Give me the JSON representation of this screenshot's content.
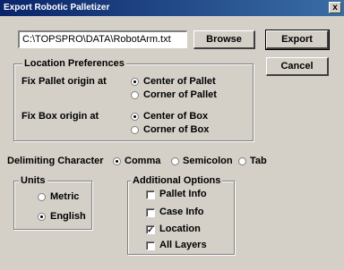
{
  "window": {
    "title": "Export Robotic Palletizer",
    "close_glyph": "x"
  },
  "file": {
    "path_value": "C:\\TOPSPRO\\DATA\\RobotArm.txt",
    "browse_label": "Browse"
  },
  "buttons": {
    "export_label": "Export",
    "cancel_label": "Cancel"
  },
  "location_prefs": {
    "title": "Location Preferences",
    "pallet_label": "Fix Pallet origin at",
    "pallet_options": [
      "Center of Pallet",
      "Corner of Pallet"
    ],
    "pallet_selected": "Center of Pallet",
    "box_label": "Fix Box origin at",
    "box_options": [
      "Center of Box",
      "Corner of Box"
    ],
    "box_selected": "Center of Box"
  },
  "delimiter": {
    "label": "Delimiting Character",
    "options": [
      "Comma",
      "Semicolon",
      "Tab"
    ],
    "selected": "Comma"
  },
  "units": {
    "title": "Units",
    "options": [
      "Metric",
      "English"
    ],
    "selected": "English"
  },
  "additional": {
    "title": "Additional Options",
    "items": [
      {
        "label": "Pallet Info",
        "checked": false
      },
      {
        "label": "Case Info",
        "checked": false
      },
      {
        "label": "Location",
        "checked": true
      },
      {
        "label": "All Layers",
        "checked": false
      }
    ]
  }
}
